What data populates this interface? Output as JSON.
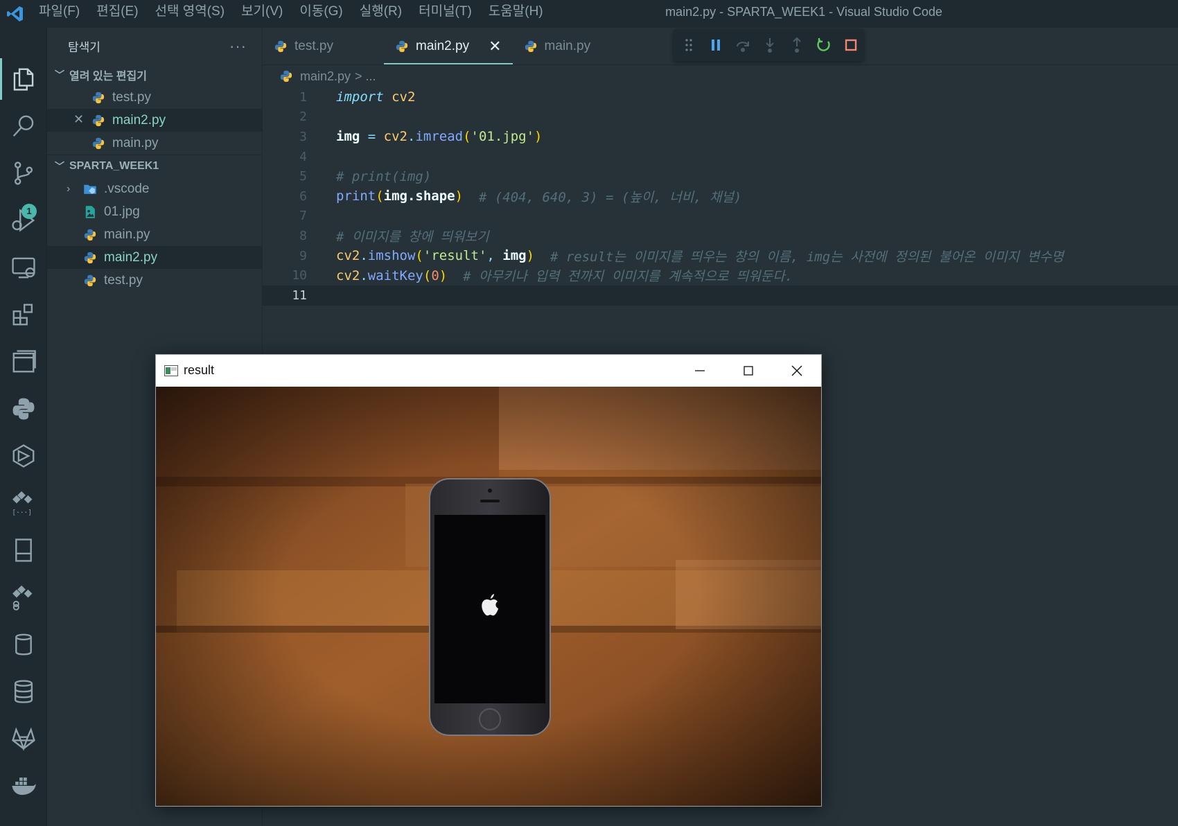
{
  "titlebar": {
    "menus": [
      "파일(F)",
      "편집(E)",
      "선택 영역(S)",
      "보기(V)",
      "이동(G)",
      "실행(R)",
      "터미널(T)",
      "도움말(H)"
    ],
    "window_title": "main2.py - SPARTA_WEEK1 - Visual Studio Code"
  },
  "activitybar": {
    "debug_badge": "1"
  },
  "sidebar": {
    "title": "탐색기",
    "more": "···",
    "open_editors": {
      "heading": "열려 있는 편집기",
      "items": [
        "test.py",
        "main2.py",
        "main.py"
      ]
    },
    "workspace": {
      "heading": "SPARTA_WEEK1",
      "items": [
        ".vscode",
        "01.jpg",
        "main.py",
        "main2.py",
        "test.py"
      ]
    }
  },
  "tabs": [
    "test.py",
    "main2.py",
    "main.py"
  ],
  "breadcrumb": {
    "file": "main2.py",
    "rest": "> ..."
  },
  "code": {
    "line_numbers": [
      "1",
      "2",
      "3",
      "4",
      "5",
      "6",
      "7",
      "8",
      "9",
      "10",
      "11"
    ],
    "l1": {
      "kw": "import",
      "mod": "cv2"
    },
    "l3": {
      "var": "img",
      "eq": " = ",
      "mod": "cv2",
      "dot": ".",
      "fn": "imread",
      "open": "(",
      "str": "'01.jpg'",
      "close": ")"
    },
    "l5": {
      "cm": "# print(img)"
    },
    "l6": {
      "fn": "print",
      "open": "(",
      "var": "img.shape",
      "close": ")",
      "cm": "  # (404, 640, 3) = (높이, 너비, 채널)"
    },
    "l8": {
      "cm": "# 이미지를 창에 띄워보기"
    },
    "l9": {
      "mod": "cv2",
      "dot": ".",
      "fn": "imshow",
      "open": "(",
      "str": "'result'",
      "comma": ", ",
      "var": "img",
      "close": ")",
      "cm": "  # result는 이미지를 띄우는 창의 이름, img는 사전에 정의된 불어온 이미지 변수명"
    },
    "l10": {
      "mod": "cv2",
      "dot": ".",
      "fn": "waitKey",
      "open": "(",
      "num": "0",
      "close": ")",
      "cm": "  # 아무키나 입력 전까지 이미지를 계속적으로 띄워둔다."
    }
  },
  "result_window": {
    "title": "result"
  },
  "colors": {
    "accent": "#80cbc4",
    "editor_bg": "#263238",
    "bar_bg": "#1f2a30"
  }
}
